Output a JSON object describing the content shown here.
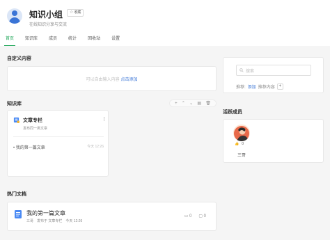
{
  "header": {
    "title": "知识小组",
    "favorite_label": "收藏",
    "description": "在线知识分享与交流"
  },
  "tabs": [
    {
      "label": "首页",
      "active": true
    },
    {
      "label": "知识库",
      "active": false
    },
    {
      "label": "成员",
      "active": false
    },
    {
      "label": "统计",
      "active": false
    },
    {
      "label": "回收站",
      "active": false
    },
    {
      "label": "设置",
      "active": false
    }
  ],
  "custom_content": {
    "title": "自定义内容",
    "hint": "可以自由输入内容",
    "link": "点击添加"
  },
  "search": {
    "placeholder": "搜索",
    "recommend_prefix": "推荐:",
    "recommend_add": "添加",
    "recommend_suffix": "推荐内容"
  },
  "knowledge_base": {
    "title": "知识库",
    "card": {
      "name": "文章专栏",
      "subtitle": "发布同一类文章",
      "items": [
        {
          "title": "我的第一篇文章",
          "time": "今天 12:26"
        }
      ]
    }
  },
  "members": {
    "title": "活跃成员",
    "list": [
      {
        "name": "三哥",
        "likes": "0"
      }
    ]
  },
  "hot_docs": {
    "title": "热门文档",
    "items": [
      {
        "title": "我的第一篇文章",
        "author": "三哥",
        "published_in": "发布于 文章专栏",
        "time": "今天 12:26",
        "likes": "0",
        "comments": "0"
      }
    ]
  },
  "colors": {
    "accent": "#22a85b",
    "link": "#3a74d6"
  }
}
